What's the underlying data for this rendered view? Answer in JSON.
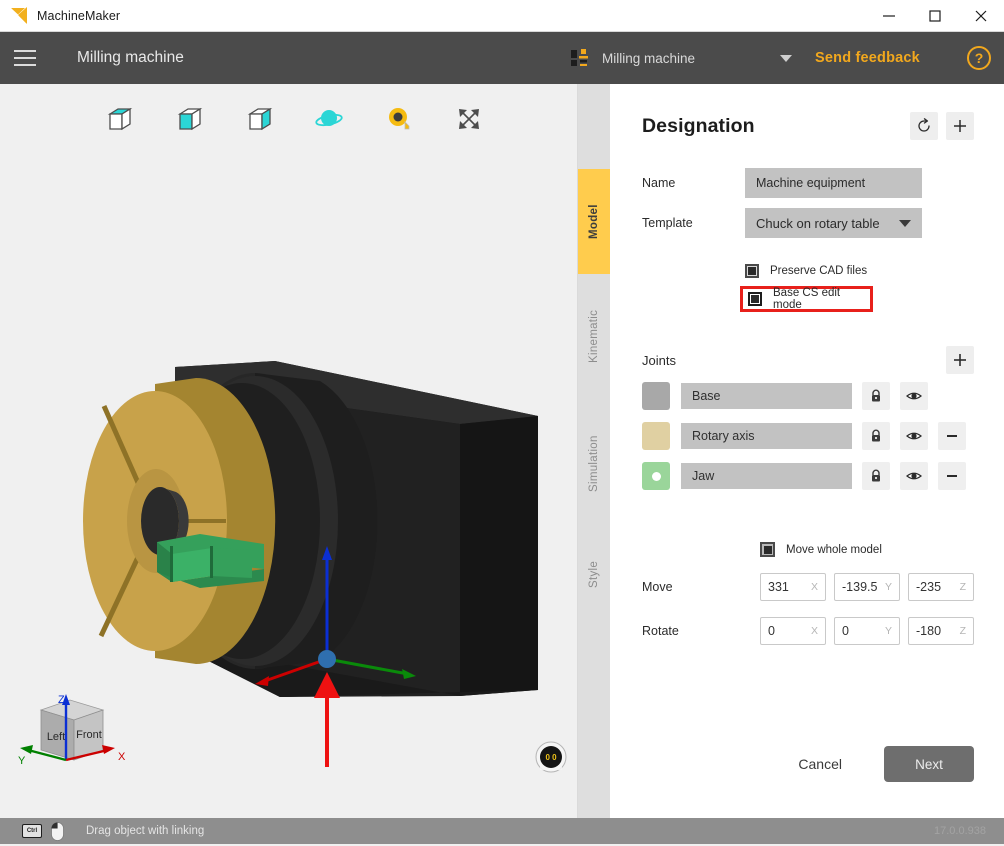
{
  "titlebar": {
    "app_name": "MachineMaker",
    "minimize": "minimize-icon",
    "maximize": "maximize-icon",
    "close": "close-icon"
  },
  "header": {
    "menu_icon": "hamburger-icon",
    "title": "Milling machine",
    "machine_selector": {
      "icon": "machine-icon",
      "value": "Milling machine",
      "caret": "chevron-down-icon"
    },
    "feedback_label": "Send feedback",
    "help_label": "?",
    "accent_color": "#f2a81d",
    "background_color": "#4b4b4b"
  },
  "viewport": {
    "toolbar": [
      {
        "name": "view-top-icon",
        "label": "Top view"
      },
      {
        "name": "view-front-icon",
        "label": "Front view"
      },
      {
        "name": "view-right-icon",
        "label": "Right view"
      },
      {
        "name": "orbit-icon",
        "label": "Orbit"
      },
      {
        "name": "measure-icon",
        "label": "Measure"
      },
      {
        "name": "fit-icon",
        "label": "Fit to screen"
      }
    ],
    "nav_cube": {
      "face_left": "Left",
      "face_front": "Front",
      "axis_x": "X",
      "axis_y": "Y",
      "axis_z": "Z",
      "color_x": "#cc0000",
      "color_y": "#008000",
      "color_z": "#0b2fd4"
    },
    "gauge_value": "0 0",
    "background_color": "#f0f0f0"
  },
  "tabs": [
    {
      "label": "Model",
      "active": true
    },
    {
      "label": "Kinematic",
      "active": false
    },
    {
      "label": "Simulation",
      "active": false
    },
    {
      "label": "Style",
      "active": false
    }
  ],
  "panel": {
    "title": "Designation",
    "header_buttons": [
      {
        "name": "reset-button",
        "icon": "reset-icon"
      },
      {
        "name": "add-button",
        "icon": "plus-icon"
      }
    ],
    "fields": [
      {
        "label": "Name",
        "type": "text",
        "value": "Machine equipment",
        "placeholder": ""
      },
      {
        "label": "Template",
        "type": "select",
        "value": "Chuck on rotary table"
      }
    ],
    "checkboxes": [
      {
        "label": "Preserve CAD files",
        "checked": true,
        "highlighted": false
      },
      {
        "label": "Base CS edit mode",
        "checked": true,
        "highlighted": true
      }
    ],
    "highlight_color": "#e8201b",
    "joints": {
      "title": "Joints",
      "add_label": "+",
      "items": [
        {
          "color": "#a8a8a8",
          "name": "Base",
          "has_dot": false,
          "lock": true,
          "eye": true,
          "remove": false
        },
        {
          "color": "#e0d0a2",
          "name": "Rotary axis",
          "has_dot": false,
          "lock": true,
          "eye": true,
          "remove": true
        },
        {
          "color": "#9ad59a",
          "name": "Jaw",
          "has_dot": true,
          "lock": true,
          "eye": true,
          "remove": true
        }
      ]
    },
    "move_whole_model": {
      "label": "Move whole model",
      "checked": true
    },
    "transform": [
      {
        "label": "Move",
        "axes": [
          {
            "axis": "X",
            "value": "331"
          },
          {
            "axis": "Y",
            "value": "-139.5"
          },
          {
            "axis": "Z",
            "value": "-235"
          }
        ]
      },
      {
        "label": "Rotate",
        "axes": [
          {
            "axis": "X",
            "value": "0"
          },
          {
            "axis": "Y",
            "value": "0"
          },
          {
            "axis": "Z",
            "value": "-180"
          }
        ]
      }
    ],
    "cancel_label": "Cancel",
    "next_label": "Next"
  },
  "statusbar": {
    "key_hint": "Ctrl",
    "mouse_icon": "mouse-icon",
    "message": "Drag object with linking",
    "version": "17.0.0.938"
  }
}
